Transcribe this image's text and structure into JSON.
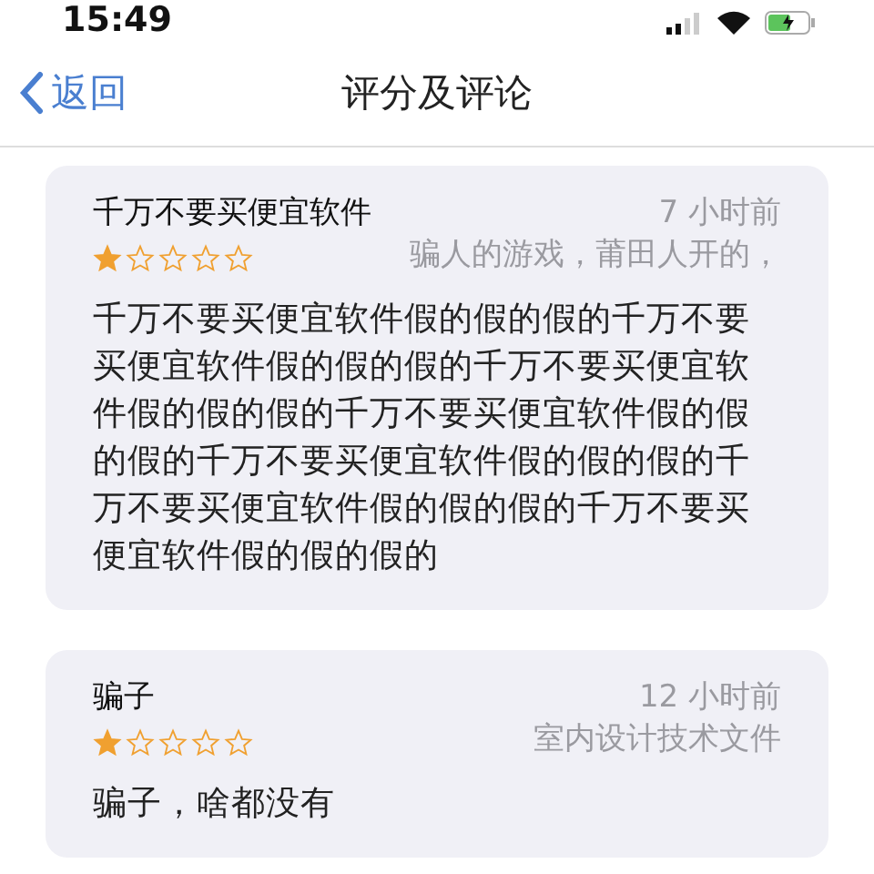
{
  "status_bar": {
    "time": "15:49"
  },
  "nav": {
    "back": "返回",
    "title": "评分及评论"
  },
  "reviews": [
    {
      "title": "千万不要买便宜软件",
      "time": "7 小时前",
      "stars": 1,
      "author": "骗人的游戏，莆田人开的，",
      "body": "千万不要买便宜软件假的假的假的千万不要买便宜软件假的假的假的千万不要买便宜软件假的假的假的千万不要买便宜软件假的假的假的千万不要买便宜软件假的假的假的千万不要买便宜软件假的假的假的千万不要买便宜软件假的假的假的"
    },
    {
      "title": "骗子",
      "time": "12 小时前",
      "stars": 1,
      "author": "室内设计技术文件",
      "body": "骗子，啥都没有"
    }
  ]
}
